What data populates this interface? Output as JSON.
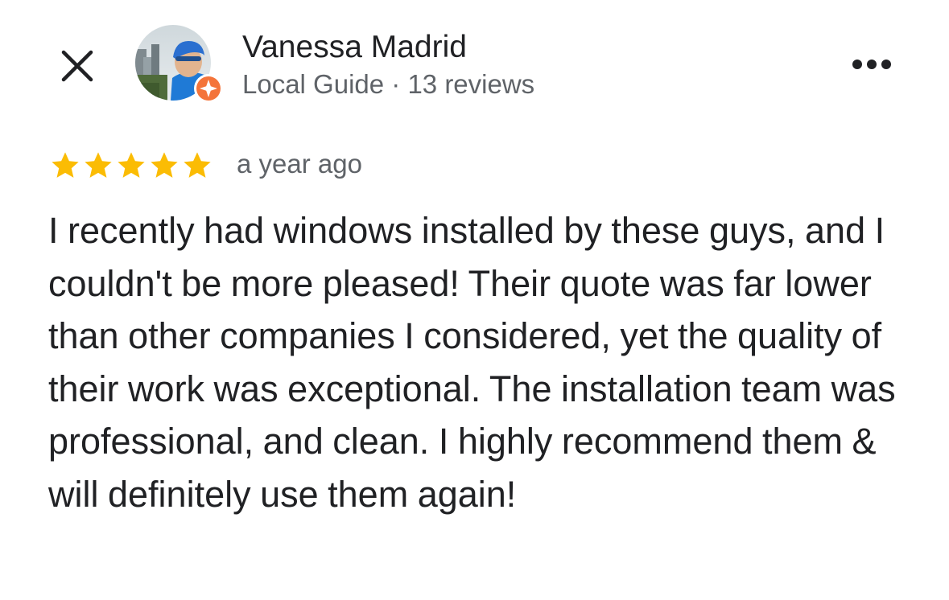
{
  "reviewer": {
    "name": "Vanessa Madrid",
    "meta": "Local Guide · 13 reviews"
  },
  "review": {
    "rating": 5,
    "rating_max": 5,
    "time": "a year ago",
    "text": "I recently had windows installed by these guys, and I couldn't be more pleased! Their quote was far lower than other companies I considered, yet the quality of their work was exceptional. The installation team was professional, and clean. I highly recommend them & will definitely use them again!"
  },
  "icons": {
    "close": "close-icon",
    "more": "more-options-icon",
    "star": "star-icon",
    "badge": "local-guide-badge-icon"
  },
  "colors": {
    "star": "#FBBC04",
    "badge": "#F4743A",
    "text": "#202124",
    "secondary": "#5F6368"
  }
}
